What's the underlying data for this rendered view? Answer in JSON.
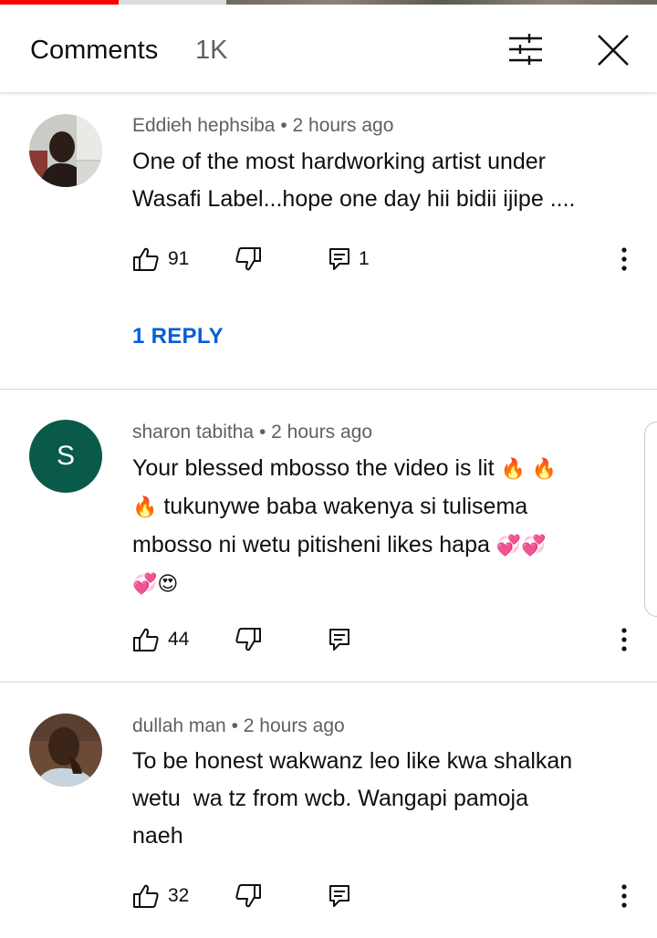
{
  "header": {
    "title": "Comments",
    "count": "1K"
  },
  "comments": [
    {
      "author": "Eddieh hephsiba",
      "time": "2 hours ago",
      "text_lines": [
        "One of the most hardworking artist under",
        "Wasafi Label...hope one day hii bidii ijipe ...."
      ],
      "likes": "91",
      "reply_count": "1",
      "replies_link": "1 REPLY"
    },
    {
      "author": "sharon tabitha",
      "time": "2 hours ago",
      "avatar_letter": "S",
      "line1": "Your blessed mbosso the video is lit ",
      "line2": " tukunywe baba wakenya si tulisema",
      "line3": "mbosso ni wetu pitisheni likes hapa ",
      "likes": "44"
    },
    {
      "author": "dullah man",
      "time": "2 hours ago",
      "text_lines": [
        "To be honest wakwanz leo like kwa shalkan",
        "wetu  wa tz from wcb. Wangapi pamoja",
        "naeh"
      ],
      "likes": "32"
    }
  ],
  "colors": {
    "accent_link": "#065fd4",
    "avatar_s": "#0a5a4a",
    "progress_played": "#ff0000"
  },
  "icons": [
    "filter-icon",
    "close-icon",
    "thumb-up-icon",
    "thumb-down-icon",
    "reply-icon",
    "more-vert-icon",
    "fire-emoji",
    "hearts-emoji",
    "heart-eyes-emoji"
  ]
}
